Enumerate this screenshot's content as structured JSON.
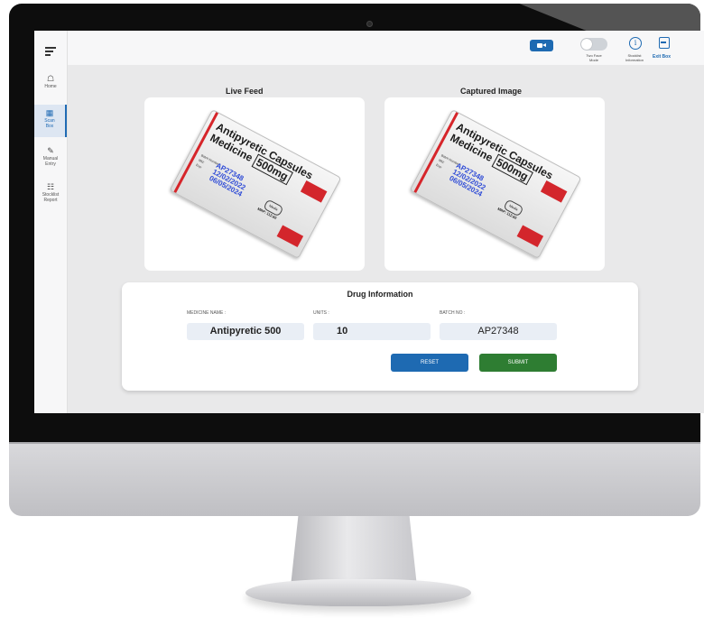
{
  "sidebar": {
    "items": [
      {
        "label": "Home"
      },
      {
        "label": "Scan Box",
        "line1": "Scan",
        "line2": "Box"
      },
      {
        "label": "Manual Entry",
        "line1": "Manual",
        "line2": "Entry"
      },
      {
        "label": "Stocklist Report",
        "line1": "Stocklist",
        "line2": "Report"
      }
    ],
    "active": "Scan Box"
  },
  "topbar": {
    "two_face_mode": {
      "line1": "Two Face",
      "line2": "Mode",
      "enabled": false
    },
    "stocklist_information": {
      "line1": "Stocklist",
      "line2": "Information"
    },
    "exit_box_label": "Exit Box"
  },
  "panels": {
    "live_feed_title": "Live Feed",
    "captured_image_title": "Captured Image"
  },
  "pack": {
    "name_line1": "Antipyretic Capsules",
    "name_line2": "Medicine",
    "strength": "500mg",
    "batch_label": "Batch Number:",
    "mfg_label": "Mfd:",
    "exp_label": "Exp:",
    "batch": "AP27348",
    "mfg_date": "12/02/2022",
    "exp_date": "06/05/2024",
    "mrp": "MRP: 112.60",
    "brand": "Medix"
  },
  "drug_info": {
    "title": "Drug Information",
    "medicine_name_label": "MEDICINE NAME :",
    "units_label": "UNITS :",
    "batch_no_label": "BATCH NO :",
    "medicine_name": "Antipyretic 500",
    "units": "10",
    "batch_no": "AP27348",
    "reset_label": "RESET",
    "submit_label": "SUBMIT"
  },
  "colors": {
    "accent_blue": "#1e6ab2",
    "submit_green": "#2e7d32",
    "pack_red": "#d6252a",
    "pack_blue_text": "#2e4bd6"
  }
}
